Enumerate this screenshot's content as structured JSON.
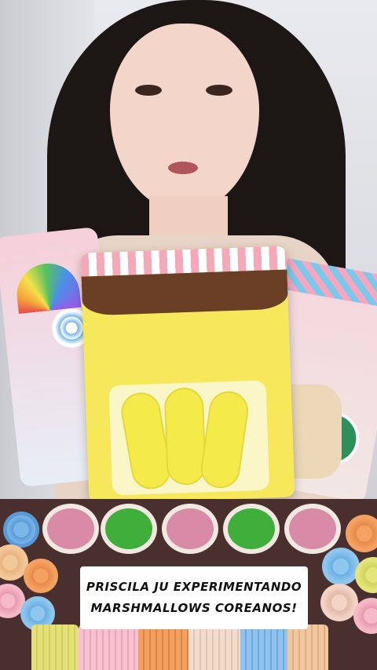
{
  "caption": {
    "line1": "PRISCILA JU EXPERIMENTANDO",
    "line2": "MARSHMALLOWS COREANOS!"
  },
  "colors": {
    "package_yellow": "#f6e85a",
    "chocolate": "#6b3e26",
    "caption_bg": "#ffffff"
  }
}
